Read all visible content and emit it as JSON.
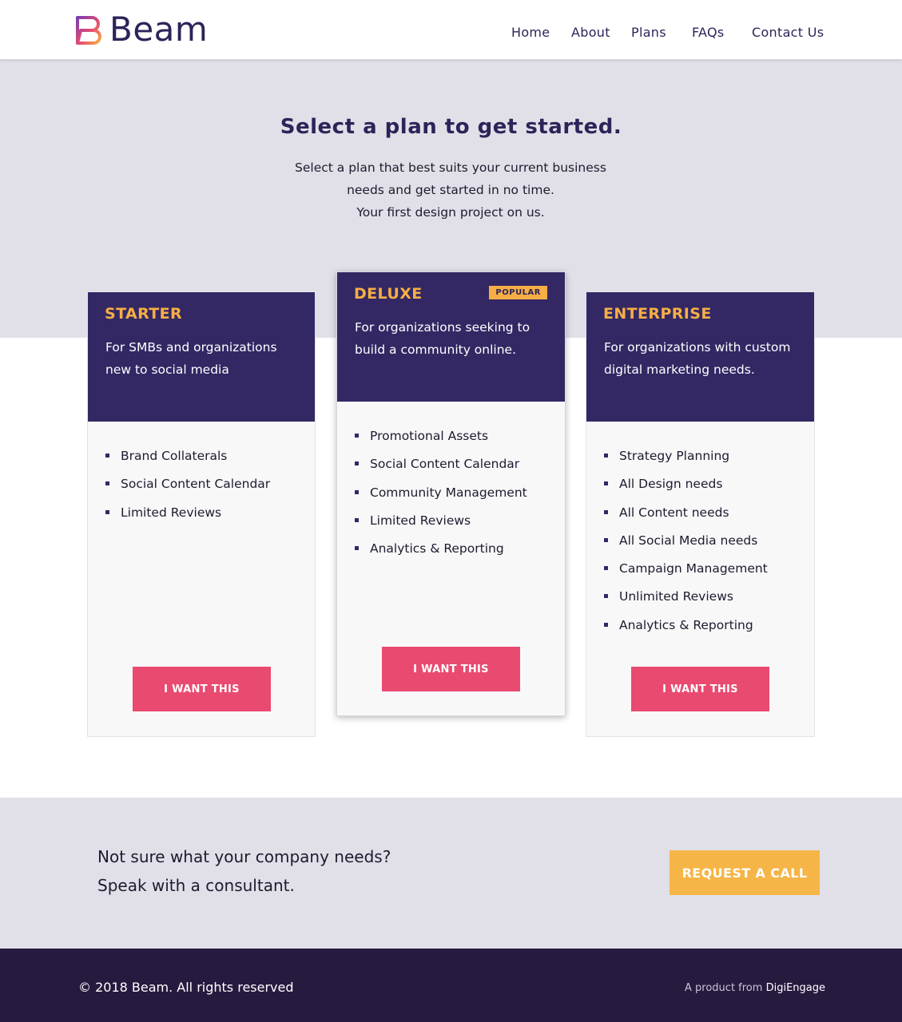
{
  "header": {
    "brand": "Beam",
    "nav": [
      "Home",
      "About",
      "Plans",
      "FAQs",
      "Contact Us"
    ]
  },
  "hero": {
    "title": "Select a plan to get started.",
    "line1": "Select a plan that best suits your current business",
    "line2": "needs and get started in no time.",
    "line3": "Your first design project on us."
  },
  "plans": [
    {
      "name": "STARTER",
      "description": "For SMBs and organizations new to social media",
      "features": [
        "Brand Collaterals",
        "Social Content Calendar",
        "Limited Reviews"
      ],
      "cta": "I WANT THIS"
    },
    {
      "name": "DELUXE",
      "badge": "POPULAR",
      "description": "For organizations seeking to build a community online.",
      "features": [
        "Promotional Assets",
        "Social Content Calendar",
        "Community Management",
        "Limited Reviews",
        "Analytics & Reporting"
      ],
      "cta": "I WANT THIS"
    },
    {
      "name": "ENTERPRISE",
      "description": "For organizations with custom digital marketing needs.",
      "features": [
        "Strategy Planning",
        "All Design needs",
        "All Content needs",
        "All Social Media needs",
        "Campaign Management",
        "Unlimited Reviews",
        "Analytics & Reporting"
      ],
      "cta": "I WANT THIS"
    }
  ],
  "consult": {
    "line1": "Not sure what your company needs?",
    "line2": "Speak with a consultant.",
    "button": "REQUEST A CALL"
  },
  "footer": {
    "copyright": "© 2018 Beam. All rights reserved",
    "product_prefix": "A product from",
    "product_name": "DigiEngage"
  },
  "colors": {
    "brand_dark": "#332864",
    "accent_orange": "#f6ae45",
    "cta_pink": "#e94a70",
    "band_gray": "#e1e0e8",
    "footer_bg": "#271a3f"
  },
  "icons": {
    "logo": "beam-logo-icon"
  }
}
